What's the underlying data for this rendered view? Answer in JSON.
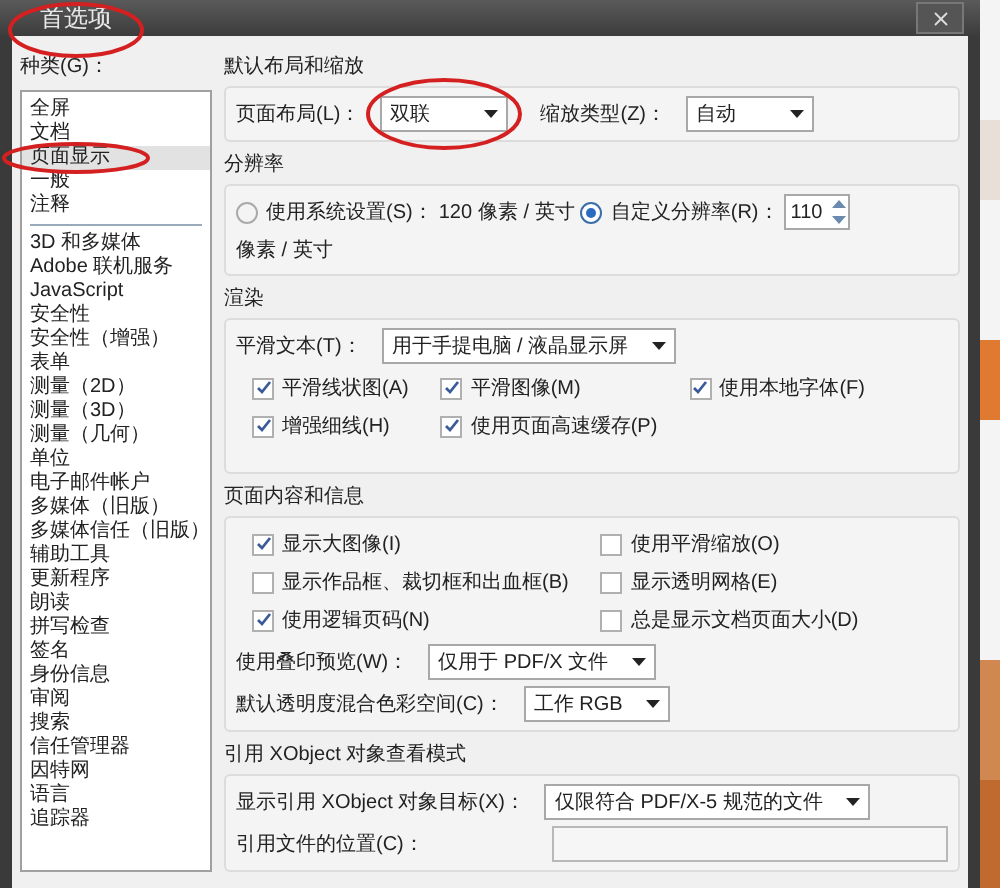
{
  "window": {
    "title": "首选项"
  },
  "categories": {
    "label": "种类(G)：",
    "groups": [
      [
        {
          "label": "全屏",
          "selected": false
        },
        {
          "label": "文档",
          "selected": false
        },
        {
          "label": "页面显示",
          "selected": true
        },
        {
          "label": "一般",
          "selected": false
        },
        {
          "label": "注释",
          "selected": false
        }
      ],
      [
        {
          "label": "3D 和多媒体",
          "selected": false
        },
        {
          "label": "Adobe 联机服务",
          "selected": false
        },
        {
          "label": "JavaScript",
          "selected": false
        },
        {
          "label": "安全性",
          "selected": false
        },
        {
          "label": "安全性（增强）",
          "selected": false
        },
        {
          "label": "表单",
          "selected": false
        },
        {
          "label": "测量（2D）",
          "selected": false
        },
        {
          "label": "测量（3D）",
          "selected": false
        },
        {
          "label": "测量（几何）",
          "selected": false
        },
        {
          "label": "单位",
          "selected": false
        },
        {
          "label": "电子邮件帐户",
          "selected": false
        },
        {
          "label": "多媒体（旧版）",
          "selected": false
        },
        {
          "label": "多媒体信任（旧版）",
          "selected": false
        },
        {
          "label": "辅助工具",
          "selected": false
        },
        {
          "label": "更新程序",
          "selected": false
        },
        {
          "label": "朗读",
          "selected": false
        },
        {
          "label": "拼写检查",
          "selected": false
        },
        {
          "label": "签名",
          "selected": false
        },
        {
          "label": "身份信息",
          "selected": false
        },
        {
          "label": "审阅",
          "selected": false
        },
        {
          "label": "搜索",
          "selected": false
        },
        {
          "label": "信任管理器",
          "selected": false
        },
        {
          "label": "因特网",
          "selected": false
        },
        {
          "label": "语言",
          "selected": false
        },
        {
          "label": "追踪器",
          "selected": false
        }
      ]
    ]
  },
  "sections": [
    {
      "title": "默认布局和缩放",
      "rows": [
        [
          {
            "kind": "select",
            "label": "页面布局(L)：",
            "value": "双联"
          },
          {
            "kind": "select",
            "label": "缩放类型(Z)：",
            "value": "自动"
          }
        ]
      ]
    },
    {
      "title": "分辨率",
      "rows": [
        [
          {
            "kind": "radio",
            "label": "使用系统设置(S)：",
            "selected": false
          },
          {
            "kind": "text",
            "text": "120"
          },
          {
            "kind": "text",
            "text": "像素 / 英寸"
          },
          {
            "kind": "radio",
            "label": "自定义分辨率(R)：",
            "selected": true
          },
          {
            "kind": "spinner",
            "value": "110"
          },
          {
            "kind": "text",
            "text": "像素 / 英寸"
          }
        ]
      ]
    },
    {
      "title": "渲染",
      "rows": [
        [
          {
            "kind": "select",
            "label": "平滑文本(T)：",
            "value": "用于手提电脑 / 液晶显示屏"
          }
        ],
        [
          {
            "kind": "checkgrid",
            "columns": [
              [
                {
                  "label": "平滑线状图(A)",
                  "checked": true
                },
                {
                  "label": "增强细线(H)",
                  "checked": true
                }
              ],
              [
                {
                  "label": "平滑图像(M)",
                  "checked": true
                },
                {
                  "label": "使用页面高速缓存(P)",
                  "checked": true
                }
              ],
              [
                {
                  "label": "使用本地字体(F)",
                  "checked": true
                }
              ]
            ]
          }
        ]
      ]
    },
    {
      "title": "页面内容和信息",
      "rows": [
        [
          {
            "kind": "checkgrid",
            "columns": [
              [
                {
                  "label": "显示大图像(I)",
                  "checked": true
                },
                {
                  "label": "显示作品框、裁切框和出血框(B)",
                  "checked": false
                },
                {
                  "label": "使用逻辑页码(N)",
                  "checked": true
                }
              ],
              [
                {
                  "label": "使用平滑缩放(O)",
                  "checked": false
                },
                {
                  "label": "显示透明网格(E)",
                  "checked": false
                },
                {
                  "label": "总是显示文档页面大小(D)",
                  "checked": false
                }
              ]
            ]
          }
        ],
        [
          {
            "kind": "select",
            "label": "使用叠印预览(W)：",
            "value": "仅用于 PDF/X 文件"
          }
        ],
        [
          {
            "kind": "select",
            "label": "默认透明度混合色彩空间(C)：",
            "value": "工作 RGB"
          }
        ]
      ]
    },
    {
      "title": "引用 XObject 对象查看模式",
      "rows": [
        [
          {
            "kind": "select",
            "label": "显示引用 XObject 对象目标(X)：",
            "value": "仅限符合 PDF/X-5 规范的文件"
          }
        ],
        [
          {
            "kind": "field",
            "label": "引用文件的位置(C)："
          }
        ]
      ]
    }
  ]
}
